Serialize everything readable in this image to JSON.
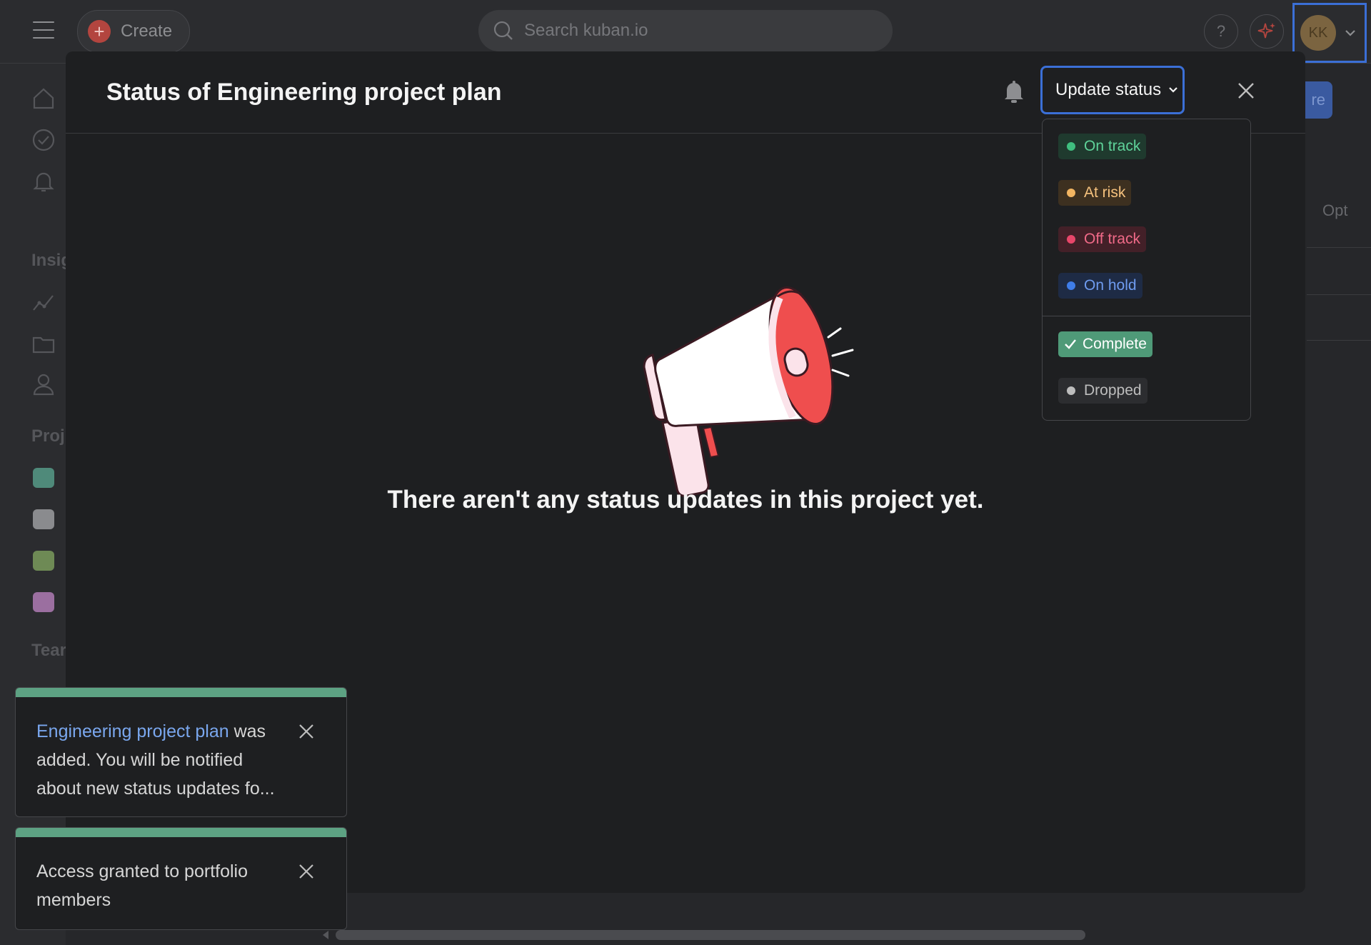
{
  "topbar": {
    "create_label": "Create",
    "search_placeholder": "Search kuban.io",
    "help_label": "?",
    "avatar_initials": "KK"
  },
  "sidebar": {
    "insights_label": "Insig",
    "projects_label": "Proj",
    "teams_label": "Tear",
    "project_colors": [
      "#4f8a7a",
      "#8a8b8e",
      "#6e8a55",
      "#9b6fa0"
    ]
  },
  "background": {
    "share_button_label": "re",
    "options_label": "Opt"
  },
  "modal": {
    "title": "Status of Engineering project plan",
    "update_status_label": "Update status",
    "empty_message": "There aren't any status updates in this project yet."
  },
  "status_menu": {
    "items": [
      {
        "label": "On track",
        "dot": "#3fbf7f",
        "bg": "#1f3a2e",
        "fg": "#5fd39a"
      },
      {
        "label": "At risk",
        "dot": "#f3b562",
        "bg": "#3d3020",
        "fg": "#f6c27e"
      },
      {
        "label": "Off track",
        "dot": "#e8466a",
        "bg": "#432028",
        "fg": "#f06a88"
      },
      {
        "label": "On hold",
        "dot": "#3f7de8",
        "bg": "#1e2b45",
        "fg": "#6f9cf0"
      }
    ],
    "complete_label": "Complete",
    "dropped_label": "Dropped"
  },
  "toasts": [
    {
      "link_text": "Engineering project plan",
      "text": " was added. You will be notified about new status updates fo..."
    },
    {
      "text": "Access granted to portfolio members"
    }
  ]
}
